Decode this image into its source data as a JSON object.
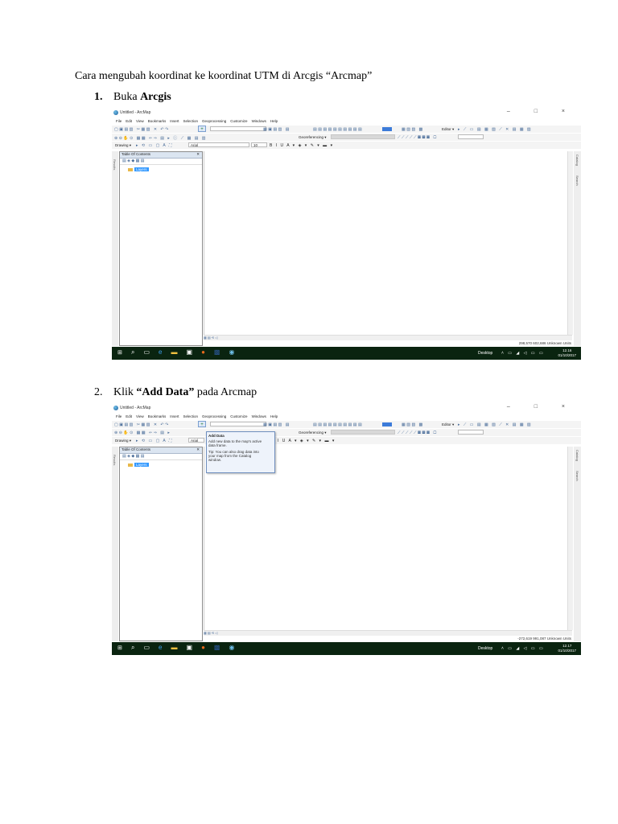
{
  "doc_title": "Cara mengubah koordinat ke koordinat UTM di Arcgis “Arcmap”",
  "steps": [
    {
      "num": "1.",
      "text_prefix": "Buka ",
      "bold": "Arcgis",
      "text_suffix": ""
    },
    {
      "num": "2.",
      "text_prefix": "Klik ",
      "bold": "“Add Data”",
      "text_suffix": " pada Arcmap"
    }
  ],
  "arcmap": {
    "window_title": "Untitled - ArcMap",
    "window_controls": "– □ ×",
    "menu": [
      "File",
      "Edit",
      "View",
      "Bookmarks",
      "Insert",
      "Selection",
      "Geoprocessing",
      "Customize",
      "Windows",
      "Help"
    ],
    "georeferencing_label": "Georeferencing ▾",
    "editor_label": "Editor ▾",
    "drawing_label": "Drawing ▾",
    "font_name": "Arial",
    "font_size": "10",
    "toc_title": "Table Of Contents",
    "toc_close": "✕",
    "layers_label": "Layers",
    "left_strip_label": "Results",
    "right_strip_catalog": "Catalog",
    "right_strip_search": "Search",
    "taskbar_desktop": "Desktop",
    "shot1": {
      "status": "298,570  602,686 Unknown Units",
      "time": "12.16",
      "date": "01/10/2017"
    },
    "shot2": {
      "status": "-272,619  991,087 Unknown Units",
      "time": "12.17",
      "date": "01/10/2017"
    },
    "tooltip": {
      "title": "Add Data",
      "line1": "Add new data to the map's active",
      "line2": "data frame.",
      "tip1": "Tip: You can also drag data into",
      "tip2": "your map from the Catalog",
      "tip3": "window."
    }
  },
  "colors": {
    "taskbar": "#0a2410",
    "toc_header": "#dbe5f1",
    "selection_blue": "#3399ff"
  }
}
